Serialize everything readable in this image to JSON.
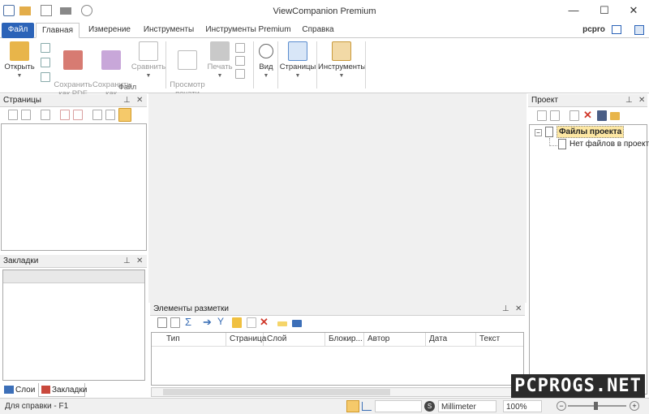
{
  "window": {
    "title": "ViewCompanion Premium",
    "minimize": "—",
    "maximize": "☐",
    "close": "✕"
  },
  "ribbon_tabs": [
    "Файл",
    "Главная",
    "Измерение",
    "Инструменты",
    "Инструменты Premium",
    "Справка"
  ],
  "user": {
    "name": "pcpro"
  },
  "ribbon": {
    "open": "Открыть",
    "save_pdf": "Сохранить\nкак PDF",
    "save_as": "Сохранить\nкак",
    "compare": "Сравнить",
    "print_preview": "Просмотр\nпечати",
    "print": "Печать",
    "group_file": "Файл",
    "view": "Вид",
    "pages": "Страницы",
    "tools": "Инструменты"
  },
  "panels": {
    "pages": {
      "title": "Страницы"
    },
    "bookmarks": {
      "title": "Закладки"
    },
    "project": {
      "title": "Проект",
      "tree_root": "Файлы проекта",
      "tree_child": "Нет файлов в проекте"
    },
    "markup": {
      "title": "Элементы разметки",
      "columns": [
        "Тип",
        "Страница",
        "Слой",
        "Блокир...",
        "Автор",
        "Дата",
        "Текст"
      ]
    }
  },
  "bottom_tabs": {
    "layers": "Слои",
    "bookmarks": "Закладки"
  },
  "status": {
    "help": "Для справки - F1",
    "units": "Millimeter",
    "zoom": "100%"
  },
  "watermark": "PCPROGS.NET",
  "colors": {
    "accent": "#2b63b8",
    "folder": "#e8b54a",
    "pdf": "#c9483c",
    "active_toolbar_icon": "#f5c96a"
  },
  "icons": {
    "minimize": "window-minimize-icon",
    "maximize": "window-maximize-icon",
    "close": "window-close-icon",
    "pin": "pin-icon"
  }
}
